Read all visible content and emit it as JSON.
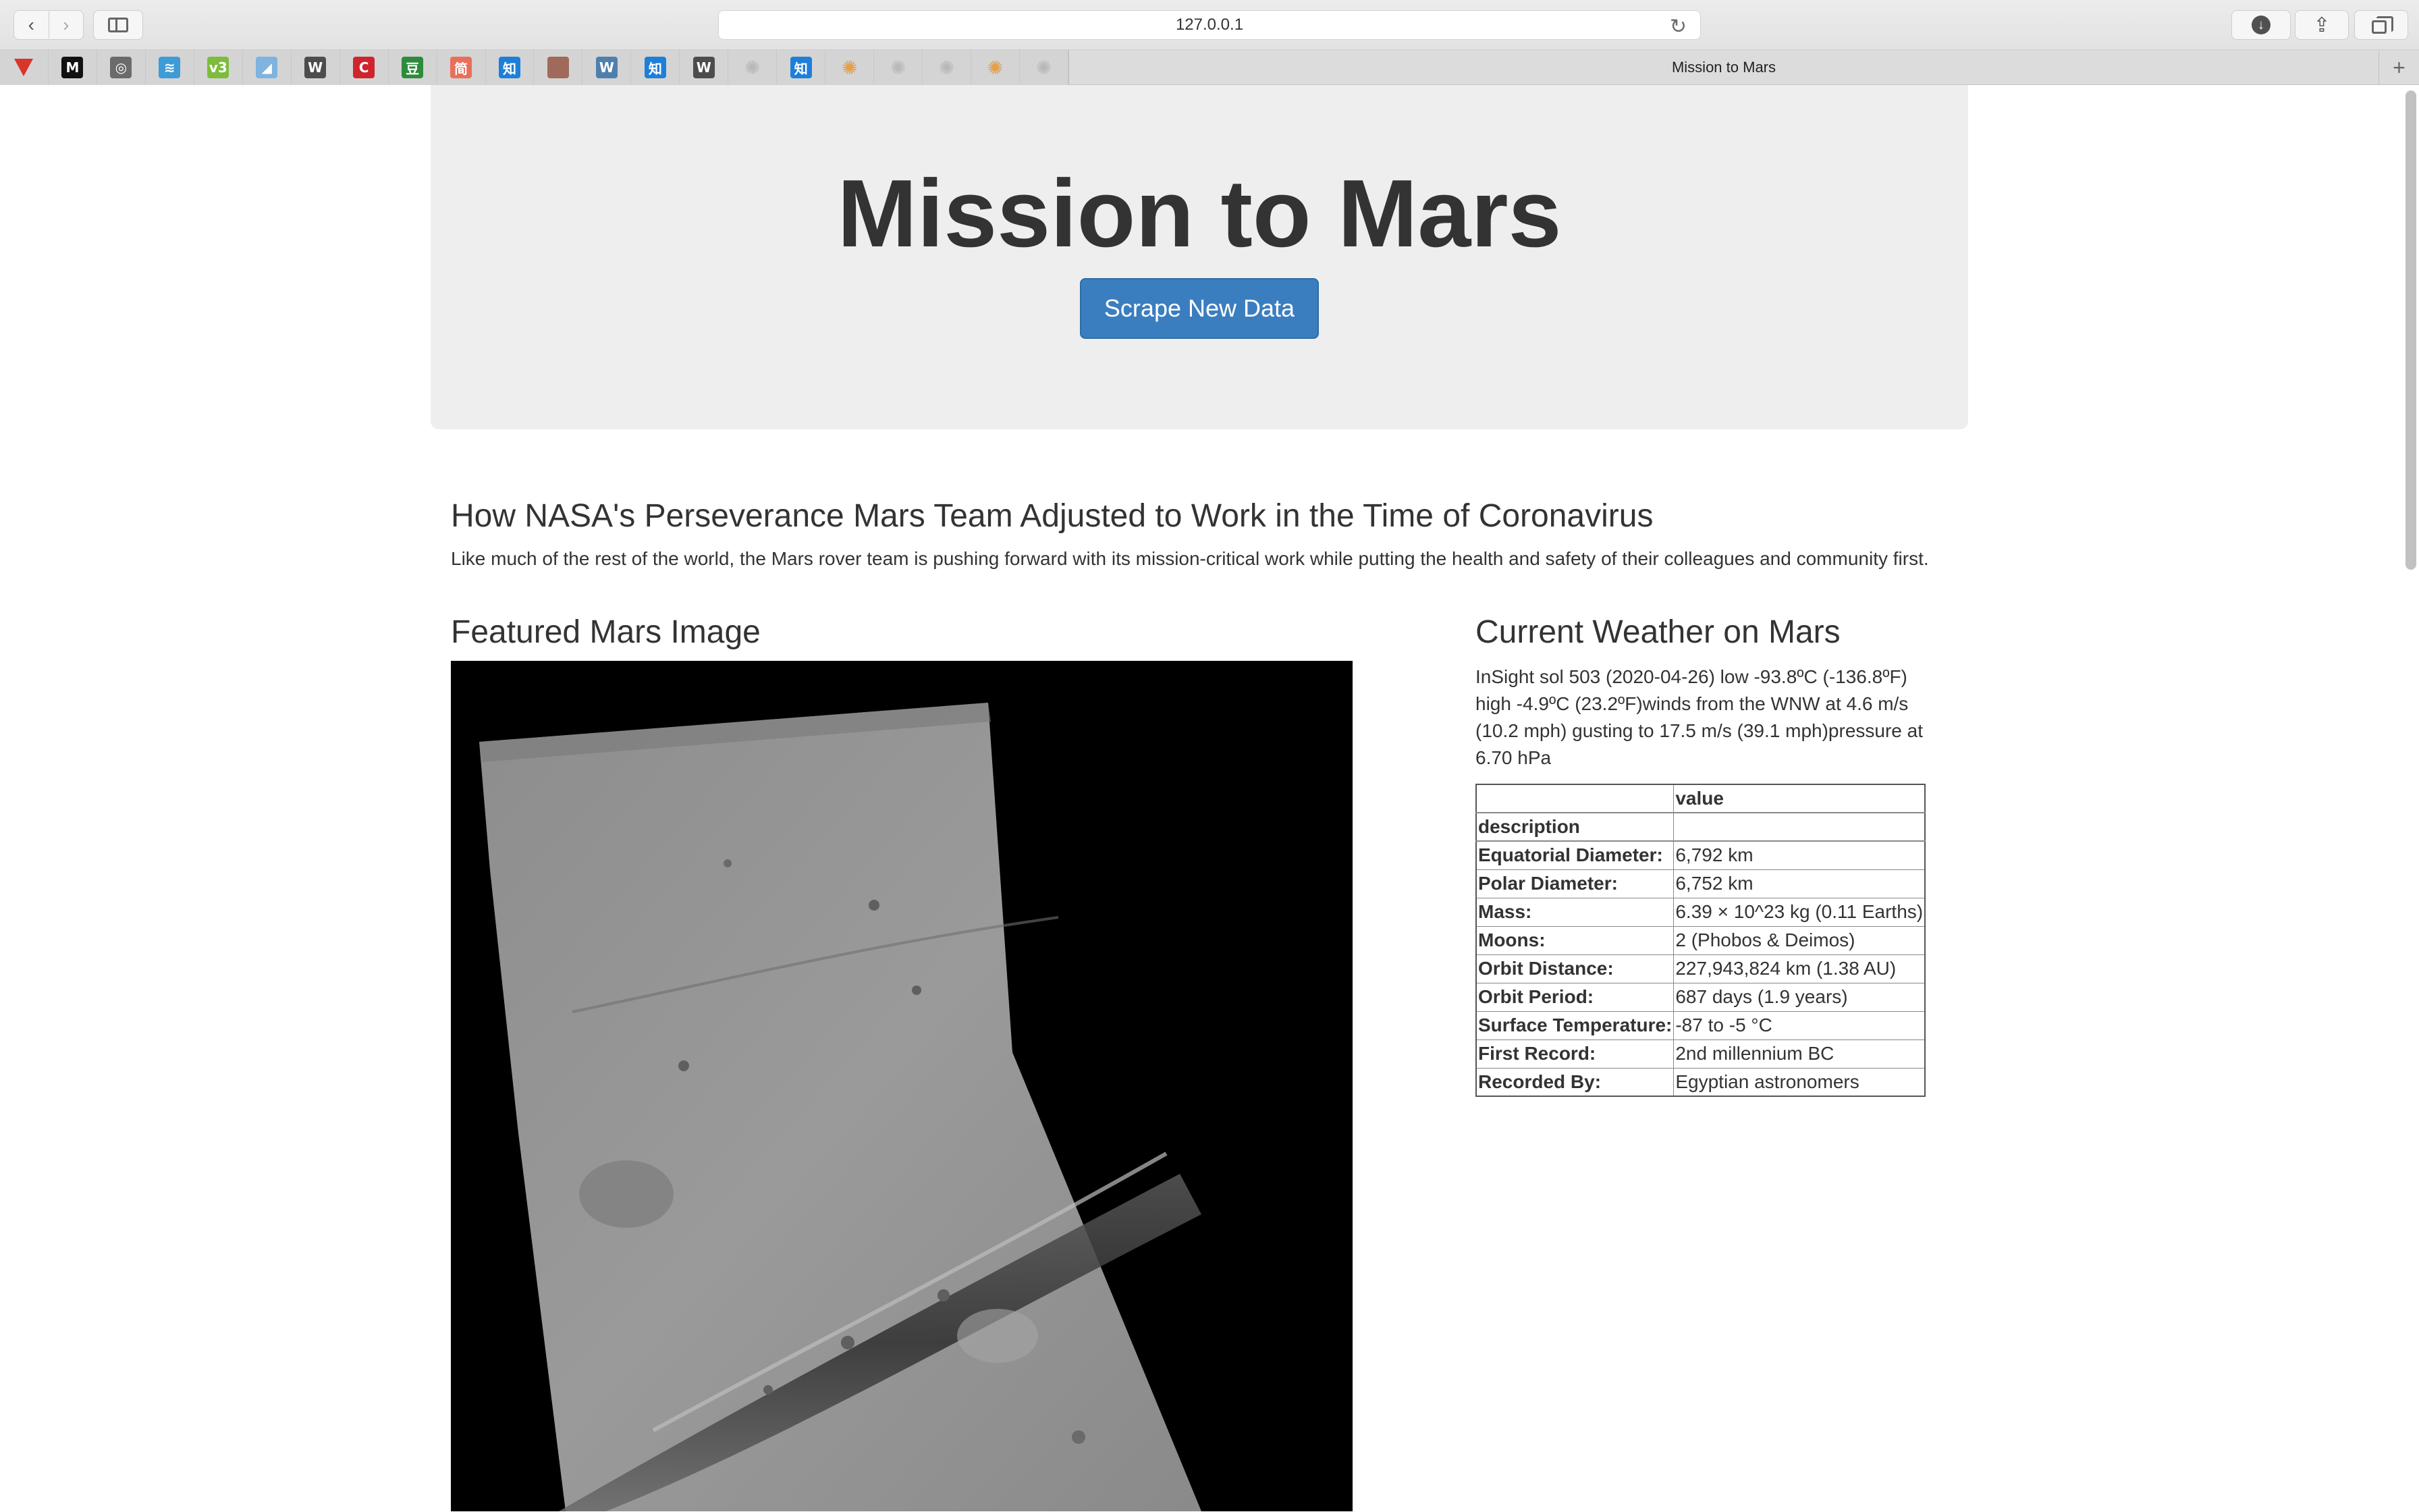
{
  "browser": {
    "address": "127.0.0.1",
    "tab_title": "Mission to Mars",
    "favorites": [
      {
        "icon": "vivaldi-red-icon",
        "glyph": "",
        "color": "#d7362b"
      },
      {
        "icon": "medium-icon",
        "glyph": "M",
        "color": "#111111"
      },
      {
        "icon": "target-circle-icon",
        "glyph": "◎",
        "color": "#6b6b6b"
      },
      {
        "icon": "layers-icon",
        "glyph": "≋",
        "color": "#3d9bd6"
      },
      {
        "icon": "v3-green-icon",
        "glyph": "v3",
        "color": "#7cbd3b"
      },
      {
        "icon": "blue-sail-icon",
        "glyph": "◢",
        "color": "#7fb3e0"
      },
      {
        "icon": "wikipedia-icon",
        "glyph": "W",
        "color": "#4d4d4d"
      },
      {
        "icon": "red-c-icon",
        "glyph": "C",
        "color": "#d0242c"
      },
      {
        "icon": "douban-icon",
        "glyph": "豆",
        "color": "#2e8b3a"
      },
      {
        "icon": "jianshu-icon",
        "glyph": "简",
        "color": "#ea6f5a"
      },
      {
        "icon": "zhihu-icon",
        "glyph": "知",
        "color": "#1e7fd9"
      },
      {
        "icon": "photo-thumbnail-icon",
        "glyph": "",
        "color": "#a06a5a"
      },
      {
        "icon": "wordpress-icon",
        "glyph": "W",
        "color": "#4f7fad"
      },
      {
        "icon": "zhihu-icon",
        "glyph": "知",
        "color": "#1e7fd9"
      },
      {
        "icon": "wikipedia-icon",
        "glyph": "W",
        "color": "#4d4d4d"
      },
      {
        "icon": "dots-wheel-icon",
        "glyph": "✺",
        "color": "#b9b9b9"
      },
      {
        "icon": "zhihu-icon",
        "glyph": "知",
        "color": "#1e7fd9"
      },
      {
        "icon": "colorful-dots-icon",
        "glyph": "✺",
        "color": "#e3a04a"
      },
      {
        "icon": "dots-wheel-icon",
        "glyph": "✺",
        "color": "#b9b9b9"
      },
      {
        "icon": "dots-wheel-icon",
        "glyph": "✺",
        "color": "#b9b9b9"
      },
      {
        "icon": "colorful-dots-icon",
        "glyph": "✺",
        "color": "#e3a04a"
      },
      {
        "icon": "dots-wheel-icon",
        "glyph": "✺",
        "color": "#b9b9b9"
      }
    ]
  },
  "page": {
    "title": "Mission to Mars",
    "scrape_button": "Scrape New Data",
    "news_title": "How NASA's Perseverance Mars Team Adjusted to Work in the Time of Coronavirus",
    "news_paragraph": "Like much of the rest of the world, the Mars rover team is pushing forward with its mission-critical work while putting the health and safety of their colleagues and community first.",
    "featured_heading": "Featured Mars Image",
    "weather_heading": "Current Weather on Mars",
    "weather_text": "InSight sol 503 (2020-04-26) low -93.8ºC (-136.8ºF) high -4.9ºC (23.2ºF)winds from the WNW at 4.6 m/s (10.2 mph) gusting to 17.5 m/s (39.1 mph)pressure at 6.70 hPa",
    "facts": {
      "header_blank": "",
      "header_value": "value",
      "index_name": "description",
      "rows": [
        {
          "label": "Equatorial Diameter:",
          "value": "6,792 km"
        },
        {
          "label": "Polar Diameter:",
          "value": "6,752 km"
        },
        {
          "label": "Mass:",
          "value": "6.39 × 10^23 kg (0.11 Earths)"
        },
        {
          "label": "Moons:",
          "value": "2 (Phobos & Deimos)"
        },
        {
          "label": "Orbit Distance:",
          "value": "227,943,824 km (1.38 AU)"
        },
        {
          "label": "Orbit Period:",
          "value": "687 days (1.9 years)"
        },
        {
          "label": "Surface Temperature:",
          "value": "-87 to -5 °C"
        },
        {
          "label": "First Record:",
          "value": "2nd millennium BC"
        },
        {
          "label": "Recorded By:",
          "value": "Egyptian astronomers"
        }
      ]
    }
  },
  "colors": {
    "button_primary": "#3b7ec0",
    "jumbotron_bg": "#eeeeee"
  }
}
